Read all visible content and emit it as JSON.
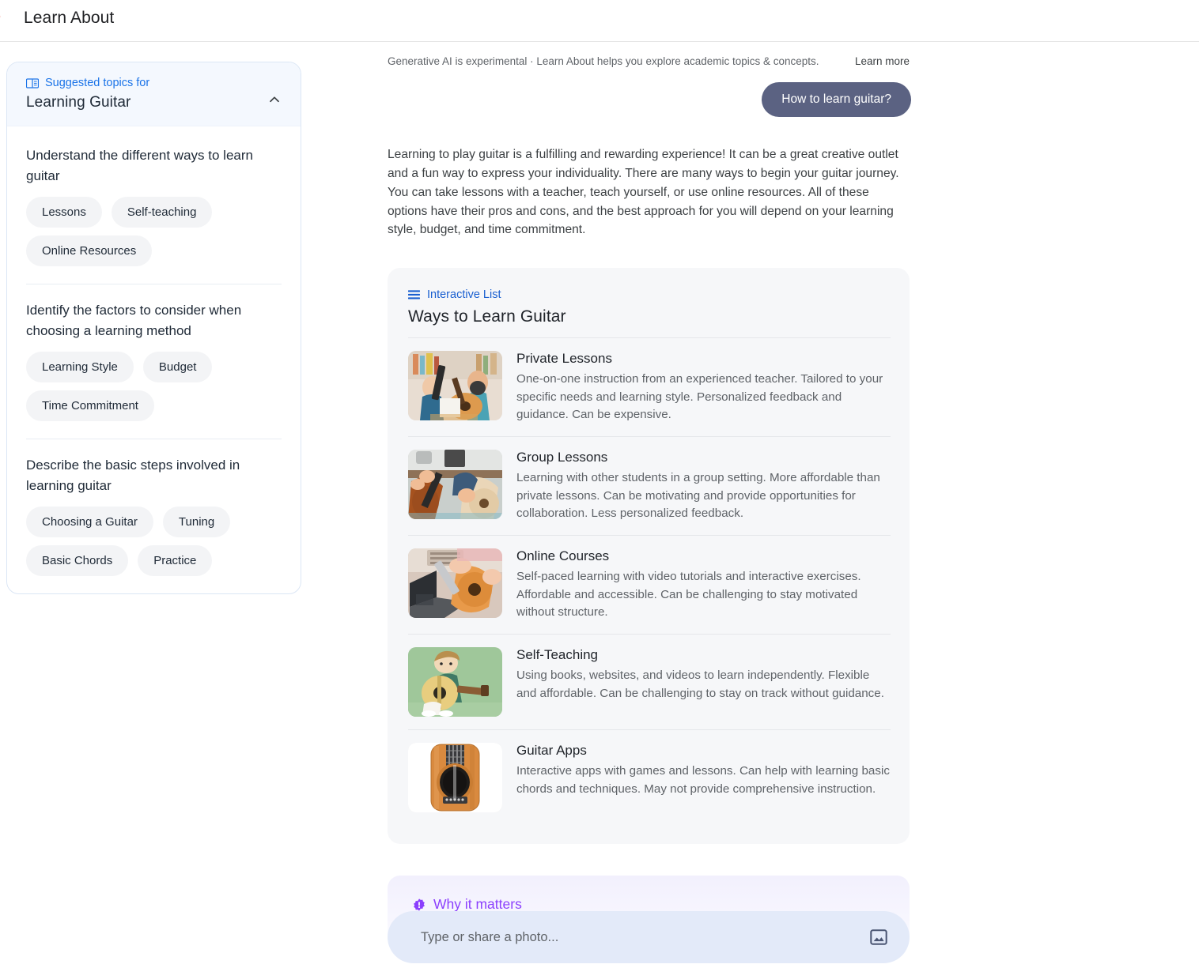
{
  "app": {
    "title": "Learn About",
    "logo_icon": "google-g-logo"
  },
  "sidebar": {
    "eyebrow": "Suggested topics for",
    "eyebrow_icon": "book-icon",
    "topic": "Learning Guitar",
    "collapse_icon": "chevron-up-icon",
    "sections": [
      {
        "question": "Understand the different ways to learn guitar",
        "chips": [
          "Lessons",
          "Self-teaching",
          "Online Resources"
        ]
      },
      {
        "question": "Identify the factors to consider when choosing a learning method",
        "chips": [
          "Learning Style",
          "Budget",
          "Time Commitment"
        ]
      },
      {
        "question": "Describe the basic steps involved in learning guitar",
        "chips": [
          "Choosing a Guitar",
          "Tuning",
          "Basic Chords",
          "Practice"
        ]
      }
    ]
  },
  "main": {
    "disclaimer": "Generative AI is experimental · Learn About helps you explore academic topics & concepts.",
    "learn_more": "Learn more",
    "user_query": "How to learn guitar?",
    "answer": "Learning to play guitar is a fulfilling and rewarding experience! It can be a great creative outlet and a fun way to express your individuality. There are many ways to begin your guitar journey. You can take lessons with a teacher, teach yourself, or use online resources. All of these options have their pros and cons, and the best approach for you will depend on your learning style, budget, and time commitment."
  },
  "interactive_list": {
    "tag": "Interactive List",
    "tag_icon": "list-icon",
    "title": "Ways to Learn Guitar",
    "items": [
      {
        "thumb_icon": "photo-two-people-guitars",
        "title": "Private Lessons",
        "description": "One-on-one instruction from an experienced teacher. Tailored to your specific needs and learning style. Personalized feedback and guidance. Can be expensive."
      },
      {
        "thumb_icon": "photo-hands-on-guitar-group",
        "title": "Group Lessons",
        "description": "Learning with other students in a group setting. More affordable than private lessons. Can be motivating and provide opportunities for collaboration. Less personalized feedback."
      },
      {
        "thumb_icon": "photo-guitar-with-laptop",
        "title": "Online Courses",
        "description": "Self-paced learning with video tutorials and interactive exercises. Affordable and accessible. Can be challenging to stay motivated without structure."
      },
      {
        "thumb_icon": "illustration-boy-with-guitar",
        "title": "Self-Teaching",
        "description": "Using books, websites, and videos to learn independently. Flexible and affordable. Can be challenging to stay on track without guidance."
      },
      {
        "thumb_icon": "app-icon-guitar",
        "title": "Guitar Apps",
        "description": "Interactive apps with games and lessons. Can help with learning basic chords and techniques. May not provide comprehensive instruction."
      }
    ]
  },
  "why_it_matters": {
    "label": "Why it matters",
    "icon": "spark-badge-icon"
  },
  "composer": {
    "placeholder": "Type or share a photo...",
    "value": "",
    "image_button_icon": "image-icon"
  },
  "colors": {
    "accent_blue": "#1a73e8",
    "list_tag_blue": "#1a5fd0",
    "query_bubble": "#5b6282",
    "why_purple": "#8b3ffd",
    "chip_bg": "#f3f4f6",
    "card_bg": "#f6f7f9",
    "composer_bg": "#e3eaf9",
    "sidebar_head_bg": "#f4f8fe"
  }
}
